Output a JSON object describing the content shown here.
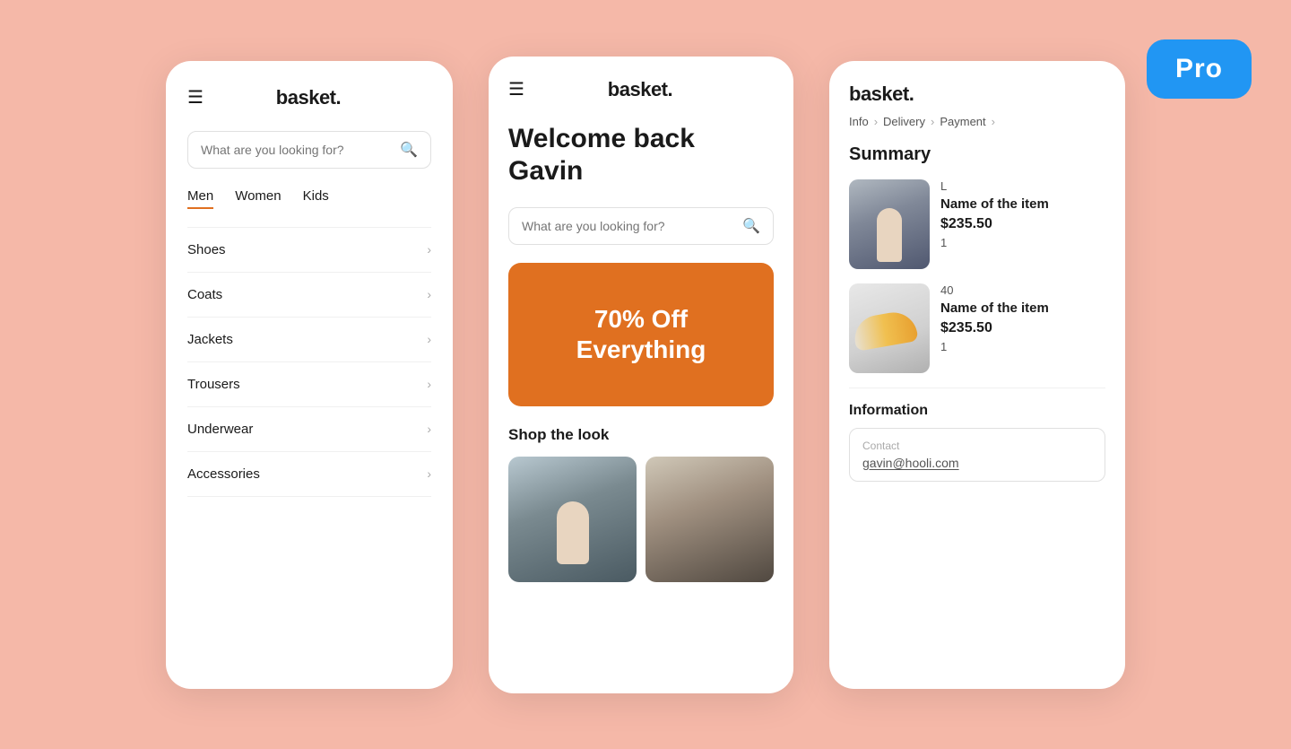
{
  "background_color": "#f5b8a8",
  "pro_badge": {
    "label": "Pro",
    "bg": "#2196F3"
  },
  "phone1": {
    "brand": "basket.",
    "search_placeholder": "What are you looking for?",
    "tabs": [
      {
        "label": "Men",
        "active": true
      },
      {
        "label": "Women",
        "active": false
      },
      {
        "label": "Kids",
        "active": false
      }
    ],
    "categories": [
      {
        "label": "Shoes"
      },
      {
        "label": "Coats"
      },
      {
        "label": "Jackets"
      },
      {
        "label": "Trousers"
      },
      {
        "label": "Underwear"
      },
      {
        "label": "Accessories"
      }
    ]
  },
  "phone2": {
    "brand": "basket.",
    "welcome_text": "Welcome back\nGavin",
    "search_placeholder": "What are you looking for?",
    "promo_text": "70% Off\nEverything",
    "shop_look_label": "Shop the look"
  },
  "phone3": {
    "brand": "basket.",
    "breadcrumb": [
      {
        "label": "Info"
      },
      {
        "label": "Delivery"
      },
      {
        "label": "Payment"
      }
    ],
    "summary_title": "Summary",
    "items": [
      {
        "size": "L",
        "name": "Name of the item",
        "price": "$235.50",
        "qty": "1"
      },
      {
        "size": "40",
        "name": "Name of the item",
        "price": "$235.50",
        "qty": "1"
      }
    ],
    "information_label": "Information",
    "contact_label": "Contact",
    "contact_value": "gavin@hooli.com"
  }
}
